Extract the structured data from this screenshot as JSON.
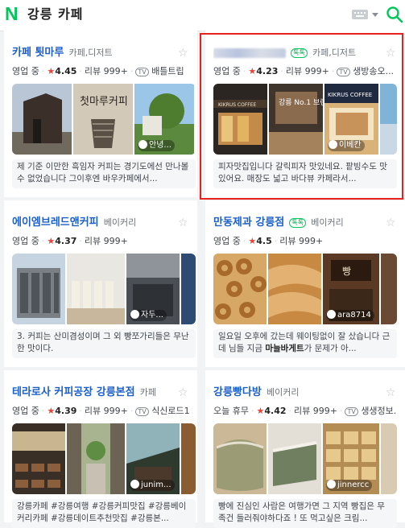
{
  "header": {
    "logo": "N",
    "query": "강릉 카페"
  },
  "cards": [
    {
      "name": "카페 툇마루",
      "category": "카페,디저트",
      "talktalk": "",
      "status": "영업 중",
      "rating": "4.45",
      "reviews": "리뷰 999+",
      "tv": "TV",
      "tv_text": "배틀트립",
      "photo_user": "안녕...",
      "review": "제 기준 이만한 흑임자 커피는 경기도에선 만나볼 수 없었습니다 그이후엔 바우카페에서..."
    },
    {
      "name": "",
      "category": "카페,디저트",
      "talktalk": "톡톡",
      "status": "영업 중",
      "rating": "4.23",
      "reviews": "리뷰 999+",
      "tv": "TV",
      "tv_text": "생방송오...",
      "sign1": "KIKRUS COFFEE",
      "sign2": "강릉 No.1 브런치 카페",
      "sign3": "KIKRUS COFFEE",
      "photo_user": "이베칸",
      "review": "피자맛집입니다 갈릭피자 맛있네요. 팥빙수도 맛있어요. 매장도 넓고 바다뷰 카페라서..."
    },
    {
      "name": "에이엠브레드앤커피",
      "category": "베이커리",
      "talktalk": "",
      "status": "영업 중",
      "rating": "4.37",
      "reviews": "리뷰 999+",
      "tv": "",
      "tv_text": "",
      "photo_user": "자두...",
      "review": "3. 커피는 산미겸성이며 그 외 빵쪼가리들은 무난한 맛이다."
    },
    {
      "name": "만동제과 강릉점",
      "category": "베이커리",
      "talktalk": "톡톡",
      "status": "영업 중",
      "rating": "4.5",
      "reviews": "리뷰 999+",
      "tv": "",
      "tv_text": "",
      "sign1": "빵",
      "photo_user": "ara8714",
      "review_pre": "일요일 오후에 갔는데 웨이팅없이 잘 샀습니다 근데 님들 지금 ",
      "review_bold": "마늘바게트",
      "review_post": "가 문제가 아..."
    },
    {
      "name": "테라로사 커피공장 강릉본점",
      "category": "카페",
      "talktalk": "",
      "status": "영업 중",
      "rating": "4.39",
      "reviews": "리뷰 999+",
      "tv": "TV",
      "tv_text": "식신로드1",
      "photo_user": "junim...",
      "review": "강릉카페 #강릉여행 #강릉커피맛집 #강릉베이커리카페 #강릉데이트추천맛집 #강릉본..."
    },
    {
      "name": "강릉빵다방",
      "category": "베이커리",
      "talktalk": "",
      "status": "오늘 휴무",
      "rating": "4.42",
      "reviews": "리뷰 999+",
      "tv": "TV",
      "tv_text": "생생정보...",
      "photo_user": "jinnercc",
      "review": "빵에 진심인 사람은 여행가면 그 지역 빵집은 무족건 들러줘야하다죠 ! 또 먹고싶은 크림..."
    }
  ],
  "colors": {
    "brand": "#03c75a",
    "link": "#1c5fc7",
    "star": "#e8453c",
    "highlight": "#e8211f"
  }
}
